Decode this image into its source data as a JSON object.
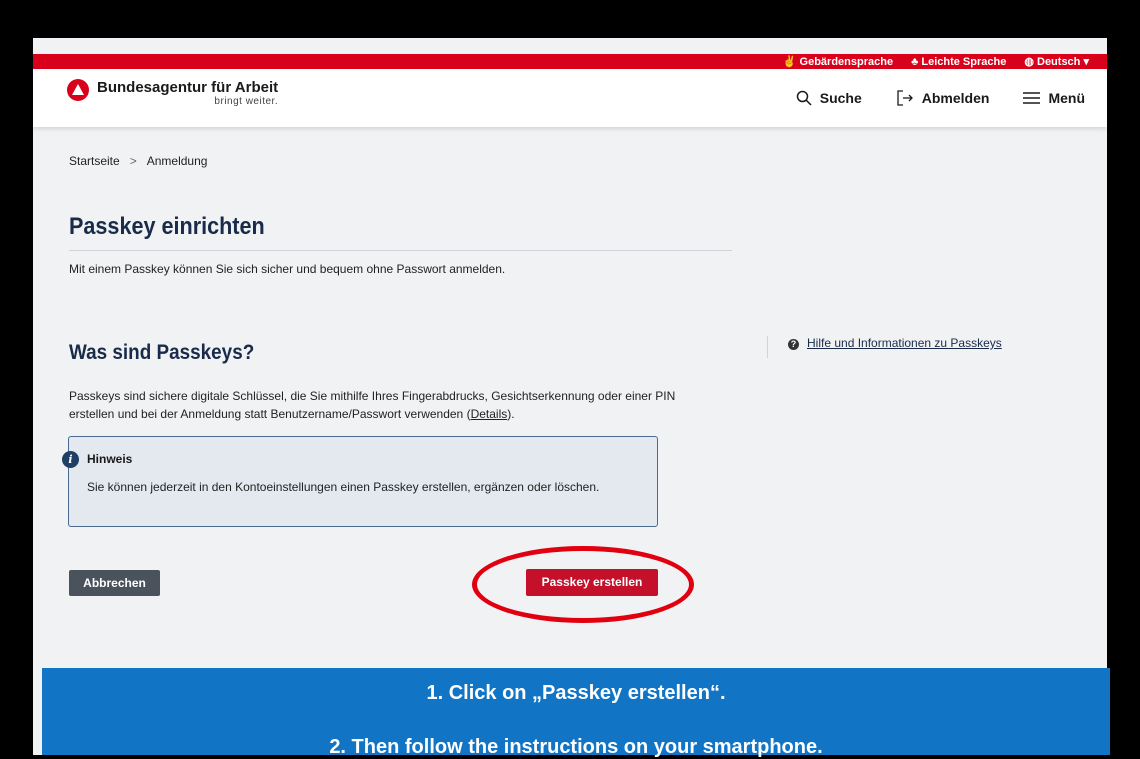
{
  "topbar": {
    "sign_language": "Gebärdensprache",
    "easy_language": "Leichte Sprache",
    "language": "Deutsch"
  },
  "header": {
    "logo_name": "Bundesagentur für Arbeit",
    "logo_claim": "bringt weiter.",
    "search": "Suche",
    "logout": "Abmelden",
    "menu": "Menü"
  },
  "breadcrumb": {
    "home": "Startseite",
    "sep": ">",
    "current": "Anmeldung"
  },
  "main": {
    "title": "Passkey einrichten",
    "intro": "Mit einem Passkey können Sie sich sicher und bequem ohne Passwort anmelden.",
    "section_title": "Was sind Passkeys?",
    "description_part1": "Passkeys sind sichere digitale Schlüssel, die Sie mithilfe Ihres Fingerabdrucks, Gesichtserkennung oder einer PIN erstellen und bei der Anmeldung statt Benutzername/Passwort verwenden (",
    "description_link": "Details",
    "description_part2": ").",
    "notice_title": "Hinweis",
    "notice_text": "Sie können jederzeit in den Kontoeinstellungen einen Passkey erstellen, ergänzen oder löschen.",
    "cancel_label": "Abbrechen",
    "create_label": "Passkey erstellen"
  },
  "aside": {
    "help_link": "Hilfe und Informationen zu Passkeys"
  },
  "banner": {
    "line1": "1. Click on „Passkey erstellen“.",
    "line2": "2. Then follow the instructions on your smartphone."
  },
  "colors": {
    "brand_red": "#d9001b",
    "primary_button": "#c4102b",
    "banner_blue": "#1174c4",
    "highlight_circle": "#e1000f"
  }
}
